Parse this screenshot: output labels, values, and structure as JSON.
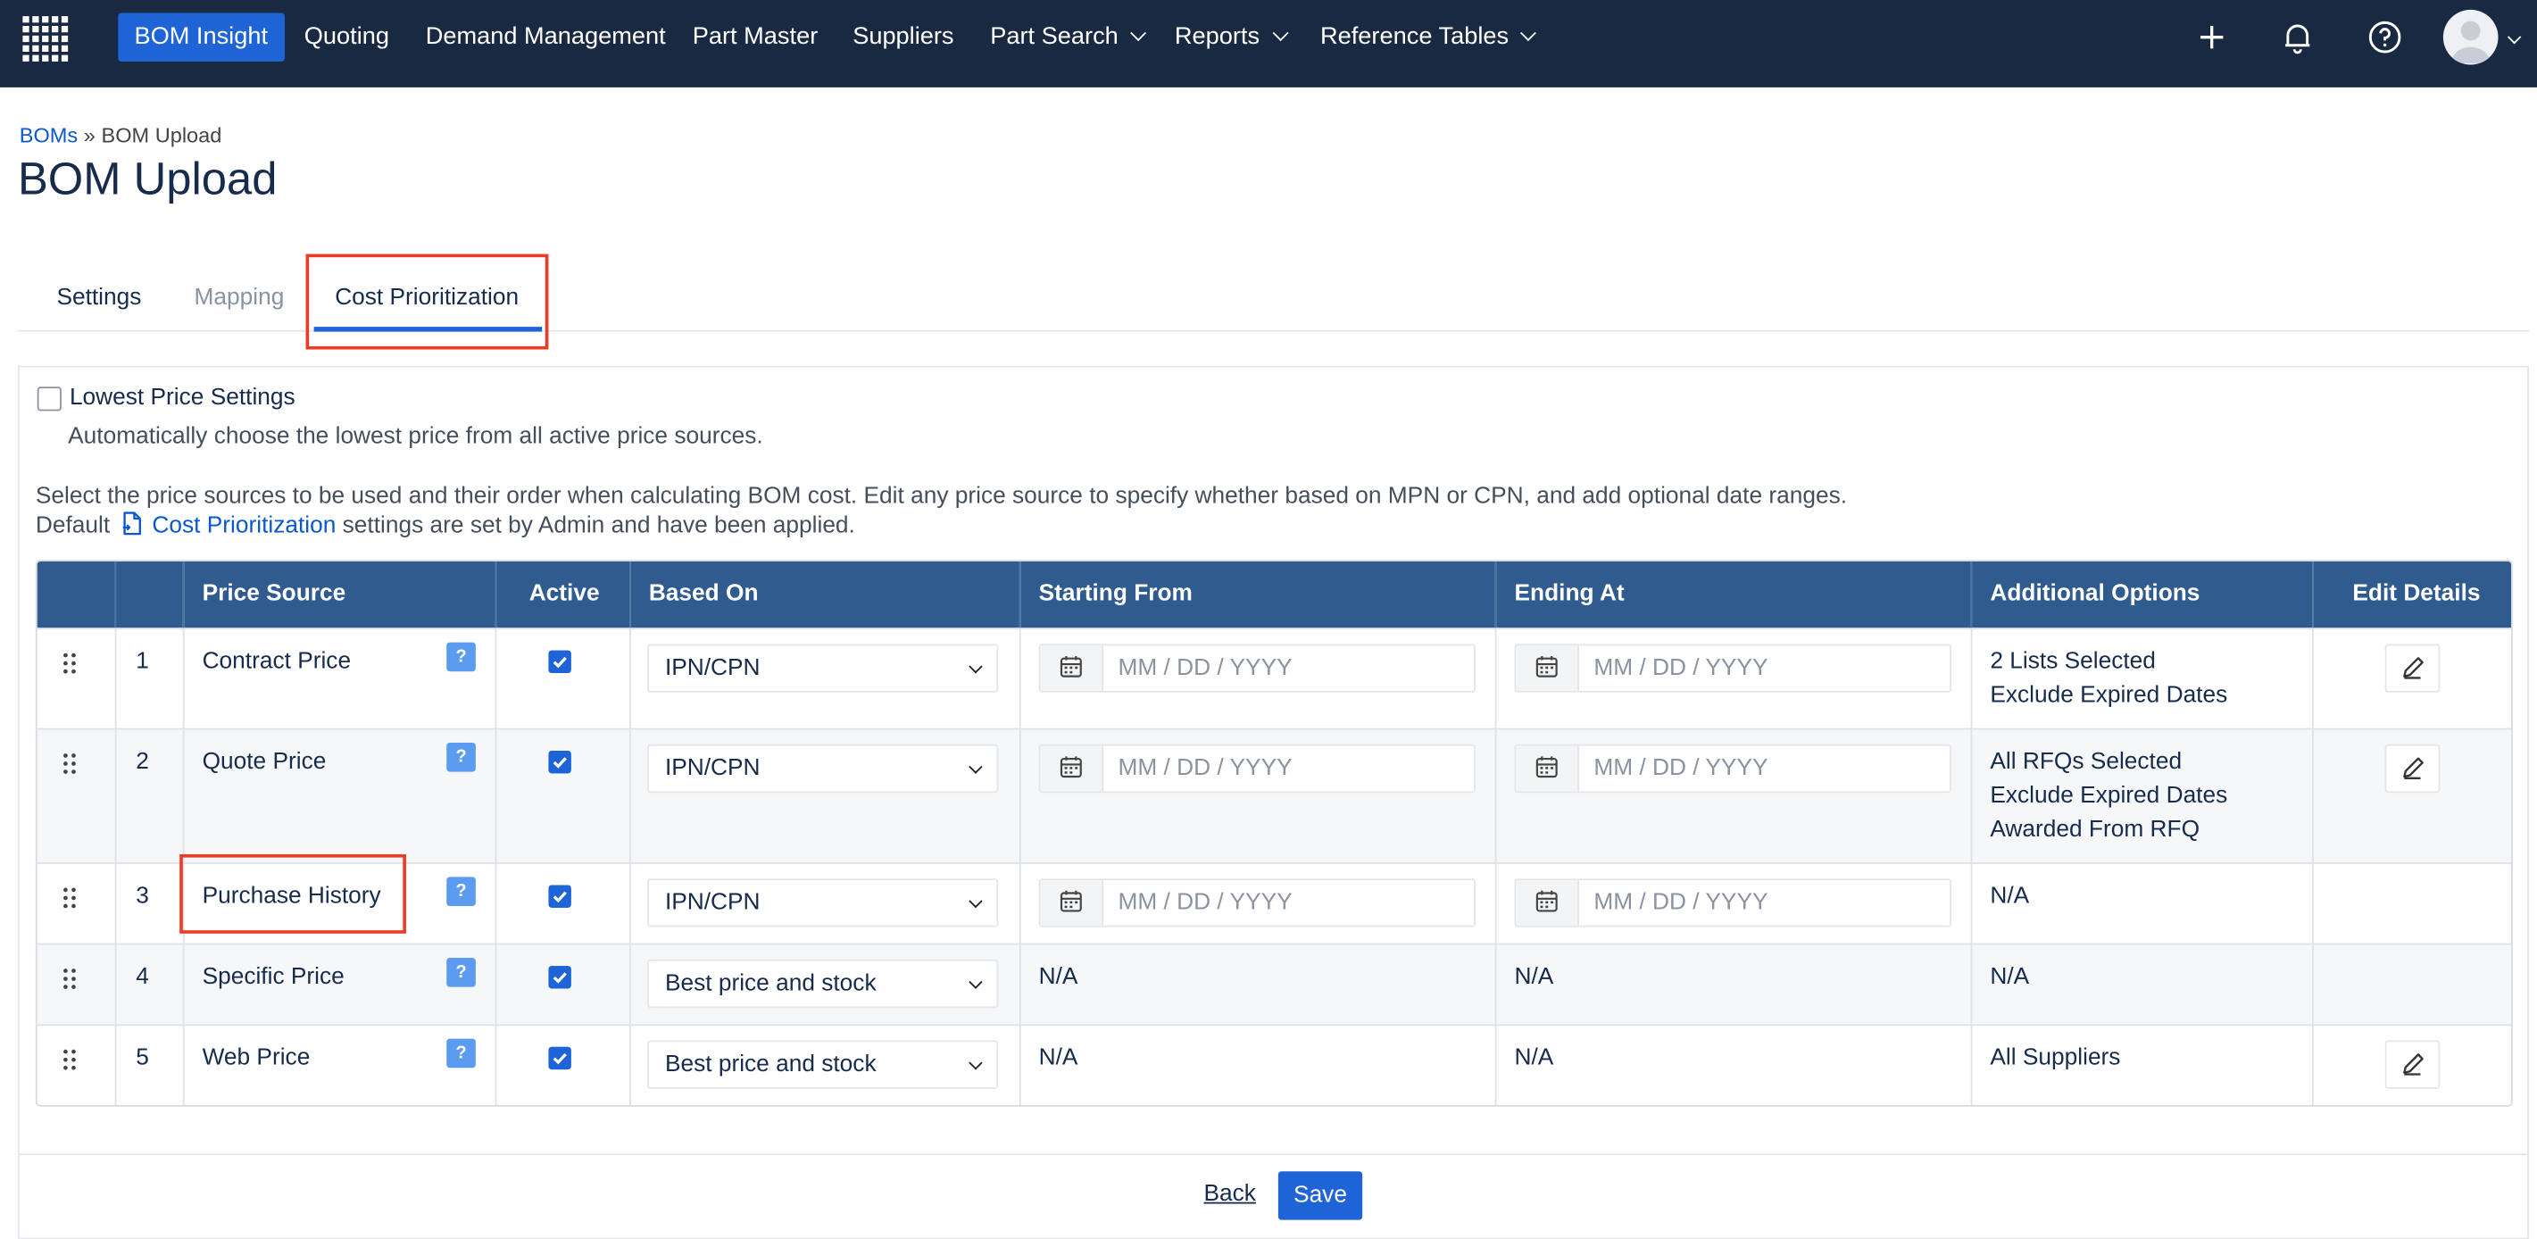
{
  "nav": {
    "items": [
      {
        "label": "BOM Insight",
        "active": true
      },
      {
        "label": "Quoting"
      },
      {
        "label": "Demand Management"
      },
      {
        "label": "Part Master"
      },
      {
        "label": "Suppliers"
      },
      {
        "label": "Part Search",
        "dropdown": true
      },
      {
        "label": "Reports",
        "dropdown": true
      },
      {
        "label": "Reference Tables",
        "dropdown": true
      }
    ],
    "icons": [
      "apps-grid-icon",
      "plus-icon",
      "bell-icon",
      "help-circle-icon",
      "avatar"
    ]
  },
  "breadcrumb": {
    "link": "BOMs",
    "separator": "»",
    "current": "BOM Upload"
  },
  "page_title": "BOM Upload",
  "tabs": [
    {
      "label": "Settings"
    },
    {
      "label": "Mapping",
      "muted": true
    },
    {
      "label": "Cost Prioritization",
      "active": true
    }
  ],
  "lowest_price": {
    "checked": false,
    "label": "Lowest Price Settings",
    "description": "Automatically choose the lowest price from all active price sources."
  },
  "info": {
    "line1": "Select the price sources to be used and their order when calculating BOM cost. Edit any price source to specify whether based on MPN or CPN, and add optional date ranges.",
    "line2_prefix": "Default",
    "line2_link": "Cost Prioritization",
    "line2_suffix": "settings are set by Admin and have been applied."
  },
  "table": {
    "headers": {
      "price_source": "Price Source",
      "active": "Active",
      "based_on": "Based On",
      "starting_from": "Starting From",
      "ending_at": "Ending At",
      "additional_options": "Additional Options",
      "edit_details": "Edit Details"
    },
    "date_placeholder": "MM / DD / YYYY",
    "help_label": "?",
    "na": "N/A",
    "rows": [
      {
        "num": "1",
        "source": "Contract Price",
        "active": true,
        "based_on": "IPN/CPN",
        "options": [
          "2 Lists Selected",
          "Exclude Expired Dates"
        ]
      },
      {
        "num": "2",
        "source": "Quote Price",
        "active": true,
        "based_on": "IPN/CPN",
        "options": [
          "All RFQs Selected",
          "Exclude Expired Dates",
          "Awarded From RFQ"
        ]
      },
      {
        "num": "3",
        "source": "Purchase History",
        "active": true,
        "based_on": "IPN/CPN",
        "options": [
          "N/A"
        ]
      },
      {
        "num": "4",
        "source": "Specific Price",
        "active": true,
        "based_on": "Best price and stock",
        "options": [
          "N/A"
        ]
      },
      {
        "num": "5",
        "source": "Web Price",
        "active": true,
        "based_on": "Best price and stock",
        "options": [
          "All Suppliers"
        ]
      }
    ]
  },
  "footer": {
    "back": "Back",
    "save": "Save"
  },
  "colors": {
    "nav_bg": "#1a2942",
    "accent": "#1f64d6",
    "table_header": "#2f5b8f",
    "highlight": "#ec3b26"
  }
}
